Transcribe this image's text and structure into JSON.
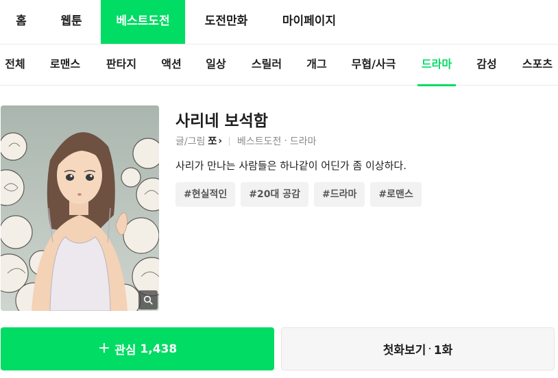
{
  "top_nav": [
    {
      "label": "홈"
    },
    {
      "label": "웹툰"
    },
    {
      "label": "베스트도전"
    },
    {
      "label": "도전만화"
    },
    {
      "label": "마이페이지"
    }
  ],
  "top_nav_active": "베스트도전",
  "genres": [
    {
      "label": "전체"
    },
    {
      "label": "로맨스"
    },
    {
      "label": "판타지"
    },
    {
      "label": "액션"
    },
    {
      "label": "일상"
    },
    {
      "label": "스릴러"
    },
    {
      "label": "개그"
    },
    {
      "label": "무협/사극"
    },
    {
      "label": "드라마"
    },
    {
      "label": "감성"
    },
    {
      "label": "스포츠"
    }
  ],
  "genre_active": "드라마",
  "work": {
    "title": "사리네 보석함",
    "author_label": "글/그림",
    "author": "쪼",
    "author_chevron": "›",
    "category": "베스트도전",
    "genre": "드라마",
    "dot": "·",
    "description": "사리가 만나는 사람들은 하나같이 어딘가 좀 이상하다.",
    "tags": [
      "#현실적인",
      "#20대 공감",
      "#드라마",
      "#로맨스"
    ]
  },
  "actions": {
    "favorite_plus": "+",
    "favorite_label": "관심",
    "favorite_count": "1,438",
    "first_label": "첫화보기",
    "first_dot": "·",
    "first_episode": "1화"
  },
  "icons": {
    "zoom": "search-icon",
    "author_link": "chevron-right-icon"
  },
  "colors": {
    "accent": "#00dc64",
    "tag_bg": "#f2f2f2",
    "text": "#1e1e1e",
    "muted": "#8a8a8a"
  }
}
